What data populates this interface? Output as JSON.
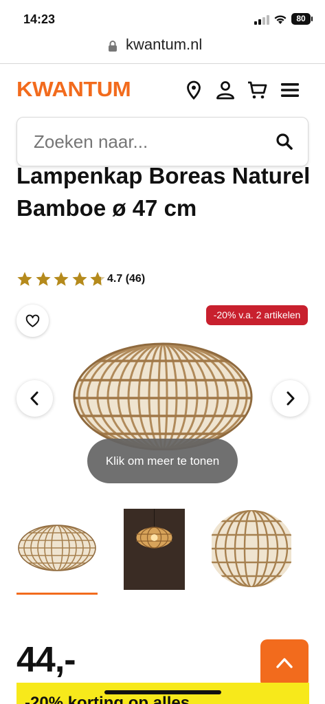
{
  "status_bar": {
    "time": "14:23",
    "battery": "80"
  },
  "browser": {
    "url": "kwantum.nl"
  },
  "header": {
    "logo": "KWANTUM",
    "icons": [
      "location-pin-icon",
      "user-icon",
      "cart-icon",
      "menu-icon"
    ],
    "accent_color": "#f26b1d"
  },
  "search": {
    "placeholder": "Zoeken naar..."
  },
  "product": {
    "title": "Lampenkap Boreas Naturel Bamboe ø 47 cm",
    "rating": {
      "value": 4.7,
      "text": "4.7 (46)",
      "stars": 4.7
    },
    "promo_badge": "-20% v.a. 2 artikelen",
    "more_button": "Klik om meer te tonen",
    "price": "44,-"
  },
  "promo_bar": {
    "text": "-20% korting op alles"
  },
  "colors": {
    "brand_orange": "#f26b1d",
    "promo_red": "#c8202e",
    "promo_yellow": "#f7e91b",
    "star_gold": "#b58a1c"
  }
}
